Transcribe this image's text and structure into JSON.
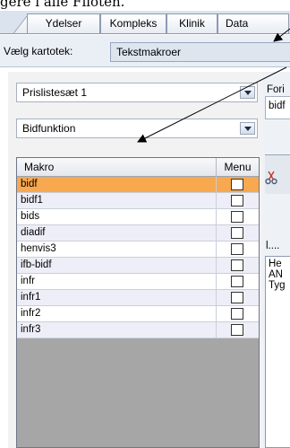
{
  "caption": "gere i alle Filoten.",
  "tabs": [
    "Ydelser",
    "Kompleks",
    "Klinik",
    "Data"
  ],
  "selector": {
    "label": "Vælg kartotek:",
    "value": "Tekstmakroer"
  },
  "combos": {
    "price_list": "Prislistesæt 1",
    "function": "Bidfunktion"
  },
  "grid": {
    "columns": [
      "Makro",
      "Menu"
    ],
    "rows": [
      {
        "makro": "bidf",
        "menu_checked": false,
        "selected": true
      },
      {
        "makro": "bidf1",
        "menu_checked": false,
        "selected": false
      },
      {
        "makro": "bids",
        "menu_checked": false,
        "selected": false
      },
      {
        "makro": "diadif",
        "menu_checked": false,
        "selected": false
      },
      {
        "makro": "henvis3",
        "menu_checked": false,
        "selected": false
      },
      {
        "makro": "ifb-bidf",
        "menu_checked": false,
        "selected": false
      },
      {
        "makro": "infr",
        "menu_checked": false,
        "selected": false
      },
      {
        "makro": "infr1",
        "menu_checked": false,
        "selected": false
      },
      {
        "makro": "infr2",
        "menu_checked": false,
        "selected": false
      },
      {
        "makro": "infr3",
        "menu_checked": false,
        "selected": false
      }
    ]
  },
  "right_panel": {
    "label": "Fori",
    "field_value": "bidf",
    "dots": "l....",
    "text_lines": [
      "He",
      "AN",
      "Tyg"
    ]
  },
  "icons": {
    "cut": "scissors-icon",
    "dropdown": "chevron-down-icon"
  },
  "colors": {
    "selected_row": "#f8a84e",
    "alt_row": "#eeeef8",
    "grid_empty": "#a6a6a6",
    "tab_bg": "#dbe3ee"
  }
}
